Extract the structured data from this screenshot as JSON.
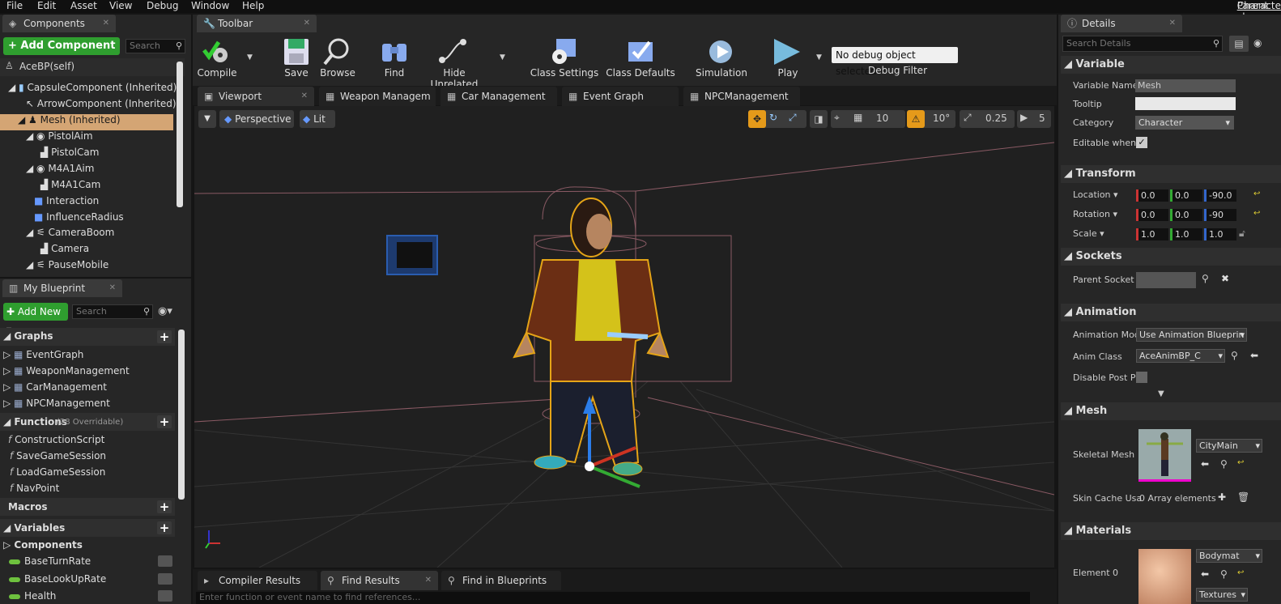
{
  "menu": [
    "File",
    "Edit",
    "Asset",
    "View",
    "Debug",
    "Window",
    "Help"
  ],
  "parent_class": {
    "label": "Parent class:",
    "value": "Characte"
  },
  "components": {
    "tab": "Components",
    "add_button": "+ Add Component",
    "search_placeholder": "Search",
    "self": "AceBP(self)",
    "tree": [
      "CapsuleComponent (Inherited)",
      "ArrowComponent (Inherited)",
      "Mesh (Inherited)",
      "PistolAim",
      "PistolCam",
      "M4A1Aim",
      "M4A1Cam",
      "Interaction",
      "InfluenceRadius",
      "CameraBoom",
      "Camera",
      "PauseMobile"
    ]
  },
  "blueprint": {
    "tab": "My Blueprint",
    "add_new": "Add New",
    "search_placeholder": "Search",
    "graphs_header": "Graphs",
    "graphs": [
      "EventGraph",
      "WeaponManagement",
      "CarManagement",
      "NPCManagement"
    ],
    "functions_header": "Functions",
    "functions_note": "(28 Overridable)",
    "functions": [
      "ConstructionScript",
      "SaveGameSession",
      "LoadGameSession",
      "NavPoint"
    ],
    "macros_header": "Macros",
    "variables_header": "Variables",
    "components_sub": "Components",
    "variables": [
      "BaseTurnRate",
      "BaseLookUpRate",
      "Health"
    ]
  },
  "toolbar": {
    "tab": "Toolbar",
    "compile": "Compile",
    "save": "Save",
    "browse": "Browse",
    "find": "Find",
    "hide_unrelated": "Hide Unrelated",
    "class_settings": "Class Settings",
    "class_defaults": "Class Defaults",
    "simulation": "Simulation",
    "play": "Play",
    "debug_select": "No debug object selected",
    "debug_filter": "Debug Filter"
  },
  "editor_tabs": [
    "Viewport",
    "Weapon Managem",
    "Car Management",
    "Event Graph",
    "NPCManagement"
  ],
  "viewport": {
    "perspective": "Perspective",
    "lit": "Lit",
    "grid_snap": "10",
    "rot_snap": "10°",
    "scale_snap": "0.25",
    "cam_speed": "5"
  },
  "bottom_tabs": [
    "Compiler Results",
    "Find Results",
    "Find in Blueprints"
  ],
  "bottom_search_placeholder": "Enter function or event name to find references...",
  "details": {
    "tab": "Details",
    "search_placeholder": "Search Details",
    "variable_header": "Variable",
    "variable_name_label": "Variable Name",
    "variable_name": "Mesh",
    "tooltip_label": "Tooltip",
    "category_label": "Category",
    "category": "Character",
    "editable_label": "Editable when I",
    "transform_header": "Transform",
    "location_label": "Location",
    "rotation_label": "Rotation",
    "scale_label": "Scale",
    "location": [
      "0.0",
      "0.0",
      "-90.0"
    ],
    "rotation": [
      "0.0",
      "0.0",
      "-90"
    ],
    "scale": [
      "1.0",
      "1.0",
      "1.0"
    ],
    "sockets_header": "Sockets",
    "parent_socket_label": "Parent Socket",
    "animation_header": "Animation",
    "anim_mode_label": "Animation Moc",
    "anim_mode": "Use Animation Blueprin",
    "anim_class_label": "Anim Class",
    "anim_class": "AceAnimBP_C",
    "disable_post_label": "Disable Post P",
    "mesh_header": "Mesh",
    "skeletal_mesh_label": "Skeletal Mesh",
    "skeletal_mesh": "CityMain",
    "skin_cache_label": "Skin Cache Usa",
    "skin_cache": "0 Array elements",
    "materials_header": "Materials",
    "element0_label": "Element 0",
    "element0": "Bodymat",
    "textures": "Textures"
  },
  "colors": {
    "accent_green": "#2f9e2f",
    "selection": "#d4a574",
    "outline": "#e5a417"
  }
}
